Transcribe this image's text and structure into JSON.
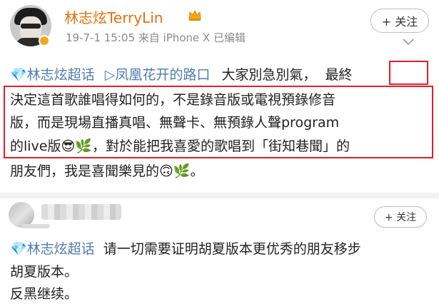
{
  "post": {
    "username": "林志炫TerryLin",
    "meta": "19-7-1 15:05 来自 iPhone X  已编辑",
    "follow_label": "+ 关注",
    "line1": {
      "topic1": "林志炫超话",
      "topic2": "凤凰花开的路口",
      "text": "大家別急別氣，",
      "boxed": "最終"
    },
    "line2": "決定這首歌誰唱得如何的，不是錄音版或電視預錄修音",
    "line3": "版，而是現場直播真唱、無聲卡、無預錄人聲program",
    "line4": {
      "text": "的live版",
      "emoji1": "😎",
      "emoji2": "🌿",
      "text2": "，對於能把我喜愛的歌唱到「街知巷聞」的"
    },
    "line5": {
      "text": "朋友們，我是喜聞樂見的",
      "emoji1": "🙃",
      "emoji2": "🌿",
      "text2": "。"
    }
  },
  "comment": {
    "follow_label": "+ 关注",
    "line1": {
      "topic": "林志炫超话",
      "text": "请一切需要证明胡夏版本更优秀的朋友移步"
    },
    "line2": "胡夏版本。",
    "line3": "反黑继续。"
  },
  "colors": {
    "accent_orange": "#e96f0c",
    "topic_blue": "#4e7cb0",
    "highlight_red": "#e21d2a"
  }
}
